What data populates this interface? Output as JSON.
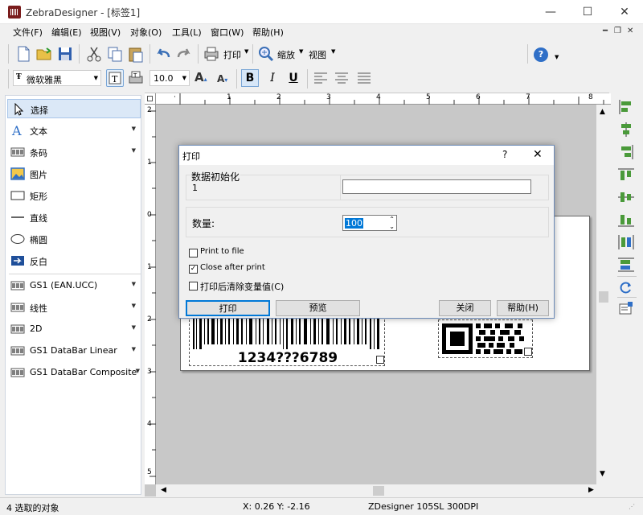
{
  "window": {
    "title": "ZebraDesigner - [标签1]",
    "minimize": "—",
    "maximize": "☐",
    "close": "✕"
  },
  "menu": [
    "文件(F)",
    "编辑(E)",
    "视图(V)",
    "对象(O)",
    "工具(L)",
    "窗口(W)",
    "帮助(H)"
  ],
  "toolbar": {
    "print_label": "打印",
    "zoom_label": "缩放",
    "view_label": "视图",
    "help_icon": "?"
  },
  "format": {
    "font": "微软雅黑",
    "size": "10.0",
    "bold": "B",
    "italic": "I",
    "underline": "U"
  },
  "tools": [
    {
      "label": "选择",
      "icon": "cursor-icon",
      "arrow": false
    },
    {
      "label": "文本",
      "icon": "text-icon",
      "arrow": true
    },
    {
      "label": "条码",
      "icon": "barcode-icon",
      "arrow": true
    },
    {
      "label": "图片",
      "icon": "picture-icon",
      "arrow": false
    },
    {
      "label": "矩形",
      "icon": "rectangle-icon",
      "arrow": false
    },
    {
      "label": "直线",
      "icon": "line-icon",
      "arrow": false
    },
    {
      "label": "椭圆",
      "icon": "ellipse-icon",
      "arrow": false
    },
    {
      "label": "反白",
      "icon": "inverse-icon",
      "arrow": false
    }
  ],
  "tools2": [
    {
      "label": "GS1 (EAN.UCC)",
      "icon": "barcode-icon",
      "arrow": true
    },
    {
      "label": "线性",
      "icon": "barcode-icon",
      "arrow": true
    },
    {
      "label": "2D",
      "icon": "barcode-icon",
      "arrow": true
    },
    {
      "label": "GS1 DataBar Linear",
      "icon": "barcode-icon",
      "arrow": true
    },
    {
      "label": "GS1 DataBar Composite",
      "icon": "barcode-icon",
      "arrow": true
    }
  ],
  "ruler": {
    "h": [
      "1",
      "2",
      "3",
      "4",
      "5",
      "6",
      "7",
      "8"
    ],
    "v": [
      "2",
      "1",
      "0",
      "1",
      "2",
      "3",
      "4",
      "5"
    ]
  },
  "label": {
    "barcode_text": "1234???6789"
  },
  "dialog": {
    "title": "打印",
    "help": "?",
    "close": "✕",
    "init_group": "数据初始化",
    "init_row": "1",
    "init_value": "",
    "qty_label": "数量:",
    "qty_value": "100",
    "print_to_file": "Print to file",
    "print_to_file_checked": false,
    "close_after_print": "Close after print",
    "close_after_print_checked": true,
    "clear_vars": "打印后清除变量值(C)",
    "clear_vars_checked": false,
    "btn_print": "打印",
    "btn_preview": "预览",
    "btn_close": "关闭",
    "btn_help": "帮助(H)"
  },
  "status": {
    "left": "4 选取的对象",
    "coords": "X: 0.26 Y: -2.16",
    "printer": "ZDesigner 105SL 300DPI"
  },
  "colors": {
    "accent": "#0078d7",
    "panel_border": "#cfd6e0",
    "dialog_border": "#6d8bb8"
  }
}
